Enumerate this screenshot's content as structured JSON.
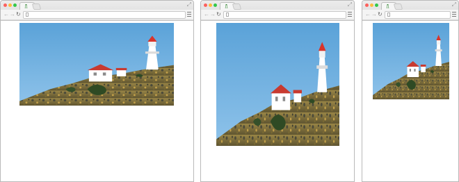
{
  "icons": {
    "back": "back-arrow-icon",
    "forward": "forward-arrow-icon",
    "reload": "reload-icon",
    "menu": "hamburger-menu-icon",
    "expand": "expand-icon",
    "page": "page-icon",
    "favicon": "lighthouse-favicon"
  },
  "colors": {
    "close": "#fc605c",
    "minimize": "#fdbc40",
    "zoom": "#34c84a",
    "sky": "#6cb0e0",
    "hill": "#8c7a3c",
    "lighthouse_roof": "#d9342b"
  },
  "browsers": [
    {
      "label": "wide-window",
      "image_alt": "Lighthouse on a hillside"
    },
    {
      "label": "medium-window",
      "image_alt": "Lighthouse on a hillside"
    },
    {
      "label": "narrow-window",
      "image_alt": "Lighthouse on a hillside"
    }
  ]
}
